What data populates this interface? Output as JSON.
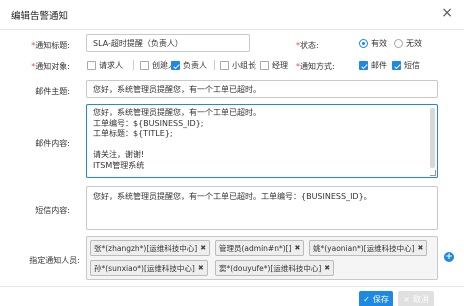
{
  "dialog": {
    "title": "编辑告警通知",
    "close_icon": "close-icon"
  },
  "fields": {
    "title_label": "通知标题:",
    "title_value": "SLA-超时提醒（负责人）",
    "status_label": "状态:",
    "status_on": "有效",
    "status_off": "无效",
    "status_selected": "有效",
    "target_label": "通知对象:",
    "targets": [
      {
        "label": "请求人",
        "checked": false
      },
      {
        "label": "创建人",
        "checked": false
      },
      {
        "label": "负责人",
        "checked": true
      },
      {
        "label": "小组长",
        "checked": false
      },
      {
        "label": "经理",
        "checked": false
      }
    ],
    "method_label": "通知方式:",
    "methods": [
      {
        "label": "邮件",
        "checked": true
      },
      {
        "label": "短信",
        "checked": true
      }
    ],
    "subject_label": "邮件主题:",
    "subject_value": "您好，系统管理员提醒您，有一个工单已超时。",
    "content_label": "邮件内容:",
    "content_lines": [
      "您好，系统管理员提醒您，有一个工单已超时。",
      "工单编号：${BUSINESS_ID};",
      "工单标题：${TITLE};",
      "",
      "请关注，谢谢!",
      "ITSM管理系统"
    ],
    "sms_label": "短信内容:",
    "sms_value": "您好，系统管理员提醒您，有一个工单已超时。工单编号：{BUSINESS_ID}。",
    "assignee_label": "指定通知人员:",
    "assignees": [
      "张*(zhangzh*)[运维科技中心]",
      "管理员(admin#n*)[]",
      "姚*(yaonian*)[运维科技中心]",
      "孙*(sunxiao*)[运维科技中心]",
      "窦*(douyufe*)[运维科技中心]"
    ]
  },
  "buttons": {
    "save": "保存",
    "cancel": "取消"
  },
  "colors": {
    "accent": "#1e88e5",
    "required": "#e74c3c"
  }
}
